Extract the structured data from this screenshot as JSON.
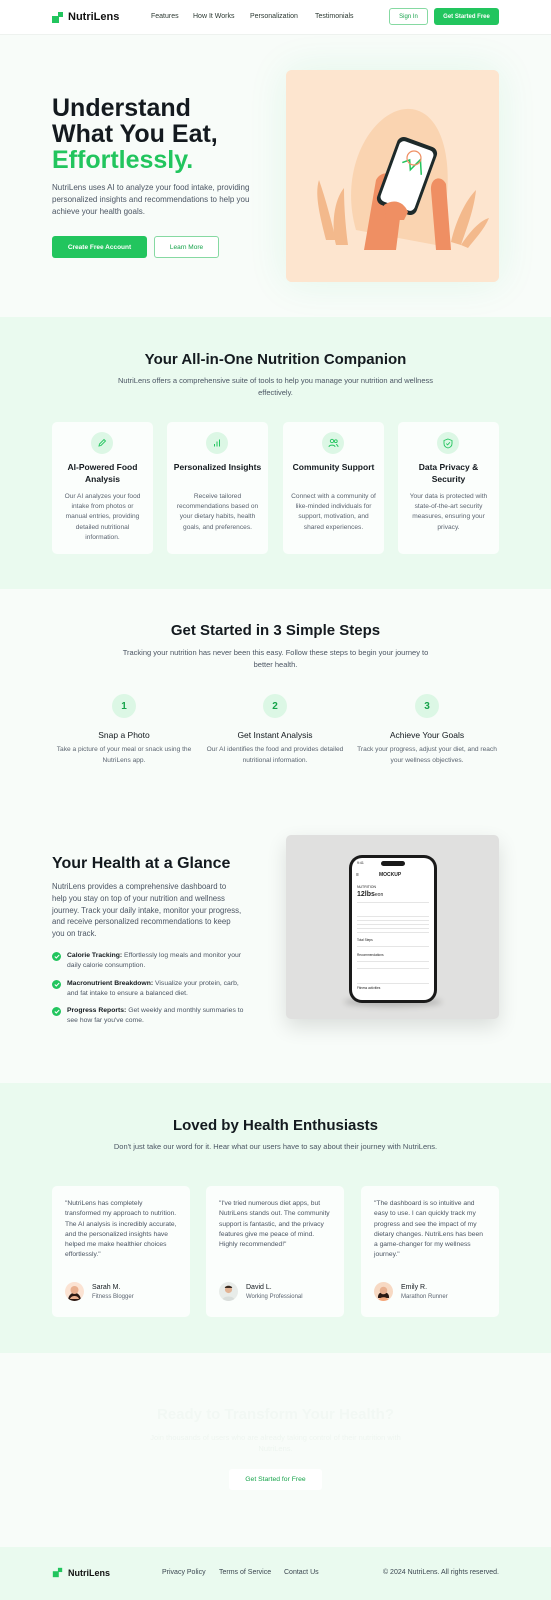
{
  "nav": {
    "brand": "NutriLens",
    "links": [
      "Features",
      "How It Works",
      "Personalization",
      "Testimonials"
    ],
    "sign_in": "Sign In",
    "get_started": "Get Started Free"
  },
  "hero": {
    "title_line1": "Understand",
    "title_line2": "What You Eat,",
    "title_accent": "Effortlessly.",
    "subtitle": "NutriLens uses AI to analyze your food intake, providing personalized insights and recommendations to help you achieve your health goals.",
    "cta_primary": "Create Free Account",
    "cta_secondary": "Learn More"
  },
  "features": {
    "title": "Your All-in-One Nutrition Companion",
    "subtitle": "NutriLens offers a comprehensive suite of tools to help you manage your nutrition and wellness effectively.",
    "items": [
      {
        "icon": "pencil-icon",
        "title": "AI-Powered Food Analysis",
        "desc": "Our AI analyzes your food intake from photos or manual entries, providing detailed nutritional information."
      },
      {
        "icon": "bar-chart-icon",
        "title": "Personalized Insights",
        "desc": "Receive tailored recommendations based on your dietary habits, health goals, and preferences."
      },
      {
        "icon": "users-icon",
        "title": "Community Support",
        "desc": "Connect with a community of like-minded individuals for support, motivation, and shared experiences."
      },
      {
        "icon": "shield-check-icon",
        "title": "Data Privacy & Security",
        "desc": "Your data is protected with state-of-the-art security measures, ensuring your privacy."
      }
    ]
  },
  "steps": {
    "title": "Get Started in 3 Simple Steps",
    "subtitle": "Tracking your nutrition has never been this easy. Follow these steps to begin your journey to better health.",
    "items": [
      {
        "num": "1",
        "title": "Snap a Photo",
        "desc": "Take a picture of your meal or snack using the NutriLens app."
      },
      {
        "num": "2",
        "title": "Get Instant Analysis",
        "desc": "Our AI identifies the food and provides detailed nutritional information."
      },
      {
        "num": "3",
        "title": "Achieve Your Goals",
        "desc": "Track your progress, adjust your diet, and reach your wellness objectives."
      }
    ]
  },
  "glance": {
    "title": "Your Health at a Glance",
    "subtitle": "NutriLens provides a comprehensive dashboard to help you stay on top of your nutrition and wellness journey. Track your daily intake, monitor your progress, and receive personalized recommendations to keep you on track.",
    "items": [
      {
        "label": "Calorie Tracking:",
        "text": " Effortlessly log meals and monitor your daily calorie consumption."
      },
      {
        "label": "Macronutrient Breakdown:",
        "text": " Visualize your protein, carb, and fat intake to ensure a balanced diet."
      },
      {
        "label": "Progress Reports:",
        "text": " Get weekly and monthly summaries to see how far you've come."
      }
    ],
    "mockup": {
      "header": "MOCKUP",
      "time": "9:41",
      "section": "NUTRITION",
      "value": "12lbs",
      "value_suffix": "eon",
      "row1": "Total Steps",
      "row2": "Recommendations",
      "row3": "Fitness activities"
    }
  },
  "testimonials": {
    "title": "Loved by Health Enthusiasts",
    "subtitle": "Don't just take our word for it. Hear what our users have to say about their journey with NutriLens.",
    "items": [
      {
        "quote": "\"NutriLens has completely transformed my approach to nutrition. The AI analysis is incredibly accurate, and the personalized insights have helped me make healthier choices effortlessly.\"",
        "name": "Sarah M.",
        "role": "Fitness Blogger"
      },
      {
        "quote": "\"I've tried numerous diet apps, but NutriLens stands out. The community support is fantastic, and the privacy features give me peace of mind. Highly recommended!\"",
        "name": "David L.",
        "role": "Working Professional"
      },
      {
        "quote": "\"The dashboard is so intuitive and easy to use. I can quickly track my progress and see the impact of my dietary changes. NutriLens has been a game-changer for my wellness journey.\"",
        "name": "Emily R.",
        "role": "Marathon Runner"
      }
    ]
  },
  "cta": {
    "title": "Ready to Transform Your Health?",
    "subtitle": "Join thousands of users who are already taking control of their nutrition with NutriLens.",
    "button": "Get Started for Free"
  },
  "footer": {
    "brand": "NutriLens",
    "links": [
      "Privacy Policy",
      "Terms of Service",
      "Contact Us"
    ],
    "copyright": "© 2024 NutriLens. All rights reserved."
  },
  "colors": {
    "accent": "#22c55e",
    "accent_dark": "#16a34a",
    "soft_green": "#eafaef",
    "peach": "#fde5cf"
  }
}
